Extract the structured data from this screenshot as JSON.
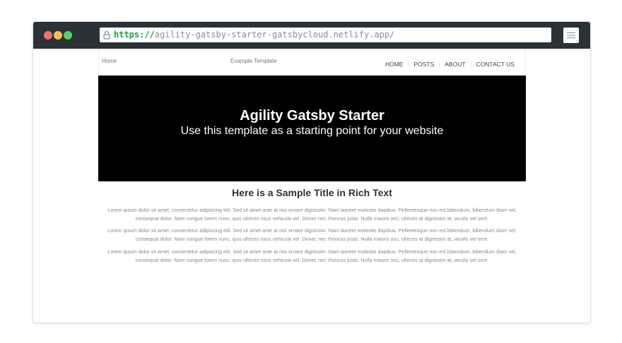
{
  "browser": {
    "url_scheme": "https://",
    "url_rest": "agility-gatsby-starter-gatsbycloud.netlify.app/"
  },
  "site": {
    "breadcrumb_home": "Home",
    "breadcrumb_template": "Example Template",
    "nav": [
      "HOME",
      "POSTS",
      "ABOUT",
      "CONTACT US"
    ],
    "hero": {
      "title": "Agility Gatsby Starter",
      "subtitle": "Use this template as a starting point for your website"
    },
    "rich_text": {
      "title": "Here is a Sample Title in Rich Text",
      "paragraphs": [
        "Lorem ipsum dolor sit amet, consectetur adipiscing elit. Sed sit amet ante at nisi ornare dignissim. Nam laoreet molestie dapibus. Pellentesque non est bibendum, bibendum diam vel, consequat dolor. Nam congue lorem nunc, quis ultrices risus vehicula vel. Donec nec rhoncus justo. Nulla mauris orci, ultrices at dignissim at, iaculis vel sem.",
        "Lorem ipsum dolor sit amet, consectetur adipiscing elit. Sed sit amet ante at nisi ornare dignissim. Nam laoreet molestie dapibus. Pellentesque non est bibendum, bibendum diam vel, consequat dolor. Nam congue lorem nunc, quis ultrices risus vehicula vel. Donec nec rhoncus justo. Nulla mauris orci, ultrices at dignissim at, iaculis vel sem.",
        "Lorem ipsum dolor sit amet, consectetur adipiscing elit. Sed sit amet ante at nisi ornare dignissim. Nam laoreet molestie dapibus. Pellentesque non est bibendum, bibendum diam vel, consequat dolor. Nam congue lorem nunc, quis ultrices risus vehicula vel. Donec nec rhoncus justo. Nulla mauris orci, ultrices at dignissim at, iaculis vel sem."
      ]
    }
  },
  "icons": {
    "window_controls": [
      "close-dot",
      "minimize-dot",
      "maximize-dot"
    ],
    "url_lock": "lock-icon",
    "menu": "menu-icon"
  },
  "colors": {
    "chrome": "#2b3235",
    "url_scheme": "#1f9d3a",
    "hero_bg": "#000000"
  }
}
